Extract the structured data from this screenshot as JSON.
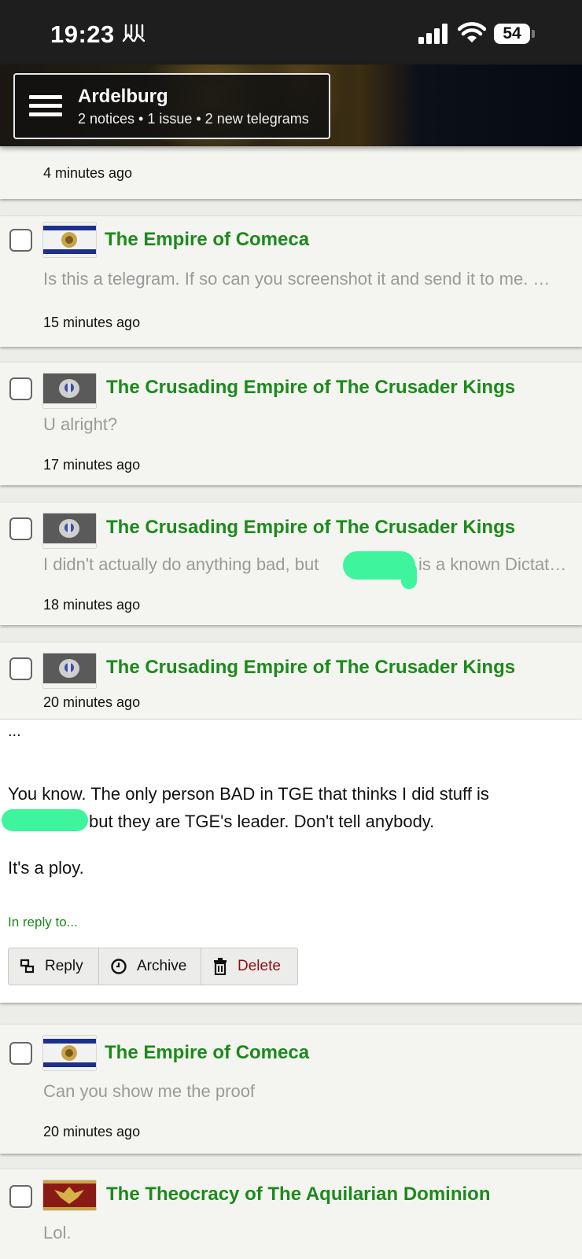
{
  "status_bar": {
    "time": "19:23",
    "battery": "54"
  },
  "header": {
    "nation": "Ardelburg",
    "summary": "2 notices • 1 issue • 2 new telegrams"
  },
  "telegrams": [
    {
      "time": "4 minutes ago"
    },
    {
      "sender": "The Empire of Comeca",
      "preview": "Is this a telegram. If so can you screenshot it and send it to me. …",
      "time": "15 minutes ago"
    },
    {
      "sender": "The Crusading Empire of The Crusader Kings",
      "preview": "U alright?",
      "time": "17 minutes ago"
    },
    {
      "sender": "The Crusading Empire of The Crusader Kings",
      "preview_before": "I didn't actually do anything bad, but",
      "preview_after": "is a known Dictat…",
      "time": "18 minutes ago"
    },
    {
      "sender": "The Crusading Empire of The Crusader Kings",
      "time": "20 minutes ago",
      "body": {
        "ellipsis": "...",
        "line1": "You know. The only person BAD in TGE that thinks I did stuff is",
        "line2": "but they are TGE's leader. Don't tell anybody.",
        "line3": "It's a ploy."
      },
      "in_reply_to": "In reply to...",
      "actions": {
        "reply": "Reply",
        "archive": "Archive",
        "delete": "Delete"
      }
    },
    {
      "sender": "The Empire of Comeca",
      "preview": "Can you show me the proof",
      "time": "20 minutes ago"
    },
    {
      "sender": "The Theocracy of The Aquilarian Dominion",
      "preview": "Lol."
    }
  ],
  "colors": {
    "sender": "#1c8a1c",
    "delete": "#8b1010",
    "redaction": "#3ef59d"
  }
}
